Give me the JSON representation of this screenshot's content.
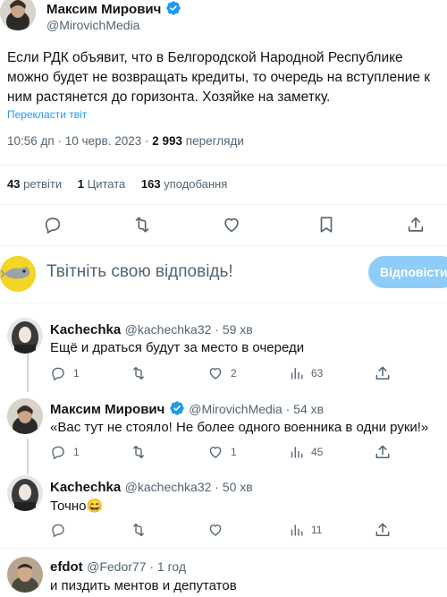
{
  "tweet": {
    "author_name": "Максим Мирович",
    "author_handle": "@MirovichMedia",
    "text": "Если РДК объявит, что в Белгородской Народной Республике можно будет не возвращать кредиты, то очередь на вступление к ним растянется до горизонта. Хозяйке на заметку.",
    "translate_label": "Перекласти твіт",
    "time": "10:56 дп · 10 черв. 2023 · ",
    "views_count": "2 993",
    "views_label": " перегляди",
    "stats": {
      "retweets_count": "43",
      "retweets_label": "ретвіти",
      "quotes_count": "1",
      "quotes_label": "Цитата",
      "likes_count": "163",
      "likes_label": "уподобання"
    }
  },
  "reply_box": {
    "placeholder": "Твітніть свою відповідь!",
    "button_label": "Відповісти"
  },
  "replies": [
    {
      "name": "Kachechka",
      "handle": "@kachechka32 · 59 хв",
      "text": "Ещё и драться будут за место в очереди",
      "replies": "1",
      "retweets": "",
      "likes": "2",
      "views": "63"
    },
    {
      "name": "Максим Мирович",
      "handle": "@MirovichMedia · 54 хв",
      "text": "«Вас тут не стояло! Не более одного военника в одни руки!»",
      "replies": "1",
      "retweets": "",
      "likes": "1",
      "views": "45"
    },
    {
      "name": "Kachechka",
      "handle": "@kachechka32 · 50 хв",
      "text": "Точно😄",
      "replies": "",
      "retweets": "",
      "likes": "",
      "views": "11"
    },
    {
      "name": "efdot",
      "handle": "@Fedor77 · 1 год",
      "text": "и пиздить ментов и депутатов"
    }
  ],
  "colors": {
    "accent": "#1d9bf0",
    "button_bg": "#8ecdf8",
    "muted": "#536471"
  }
}
